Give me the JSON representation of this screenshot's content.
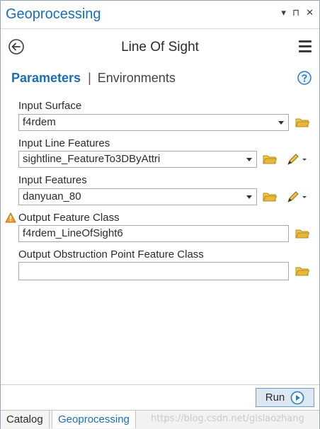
{
  "pane": {
    "title": "Geoprocessing",
    "controls": [
      "▾",
      "⊓",
      "✕"
    ]
  },
  "tool": {
    "title": "Line Of Sight"
  },
  "tabs": {
    "parameters": "Parameters",
    "separator": "|",
    "environments": "Environments"
  },
  "params": {
    "input_surface": {
      "label": "Input Surface",
      "value": "f4rdem"
    },
    "input_line_features": {
      "label": "Input Line Features",
      "value": "sightline_FeatureTo3DByAttri"
    },
    "input_features": {
      "label": "Input Features",
      "value": "danyuan_80"
    },
    "output_feature_class": {
      "label": "Output Feature Class",
      "value": "f4rdem_LineOfSight6"
    },
    "output_obstruction": {
      "label": "Output Obstruction Point Feature Class",
      "value": ""
    }
  },
  "footer": {
    "run_label": "Run"
  },
  "bottom_tabs": [
    "Catalog",
    "Geoprocessing"
  ],
  "watermark": "https://blog.csdn.net/gislaozhang",
  "colors": {
    "accent": "#1c6db5",
    "folder": "#e7b93a",
    "warning": "#f0a030"
  },
  "icons": {
    "back": "back-arrow-icon",
    "menu": "hamburger-menu-icon",
    "help": "help-icon",
    "folder": "folder-icon",
    "pencil": "sketch-pencil-icon",
    "warning": "warning-icon",
    "run": "run-play-icon"
  }
}
